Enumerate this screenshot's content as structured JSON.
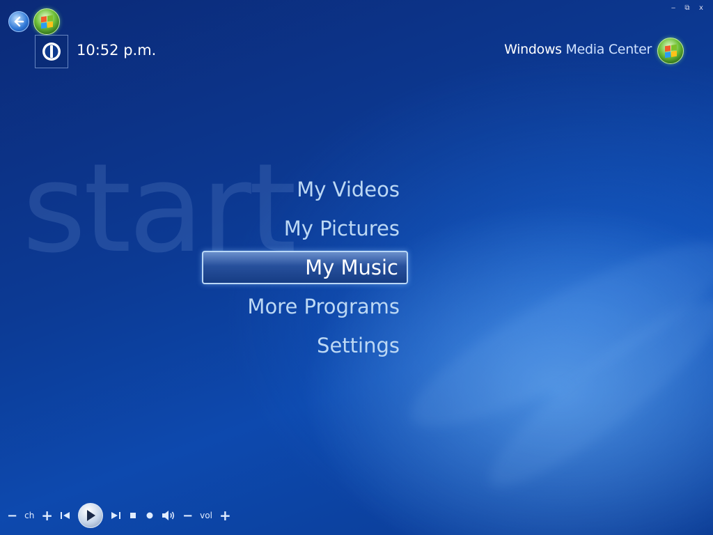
{
  "window": {
    "minimize": "‒",
    "restore": "⧉",
    "close": "x"
  },
  "header": {
    "clock": "10:52 p.m.",
    "brand_bold": "Windows",
    "brand_light": "Media Center"
  },
  "watermark": "start",
  "menu": {
    "items": [
      {
        "label": "My Videos",
        "selected": false
      },
      {
        "label": "My Pictures",
        "selected": false
      },
      {
        "label": "My Music",
        "selected": true
      },
      {
        "label": "More Programs",
        "selected": false
      },
      {
        "label": "Settings",
        "selected": false
      }
    ]
  },
  "transport": {
    "ch_minus": "−",
    "ch_label": "ch",
    "ch_plus": "+",
    "vol_minus": "−",
    "vol_label": "vol",
    "vol_plus": "+"
  },
  "icons": [
    "back-icon",
    "windows-orb-icon",
    "power-icon",
    "skip-back-icon",
    "play-icon",
    "skip-forward-icon",
    "stop-icon",
    "record-icon",
    "speaker-icon"
  ],
  "colors": {
    "accent": "#0d49ae",
    "menu_text": "#bcd8f4",
    "selected_border": "#b9d7f6"
  }
}
